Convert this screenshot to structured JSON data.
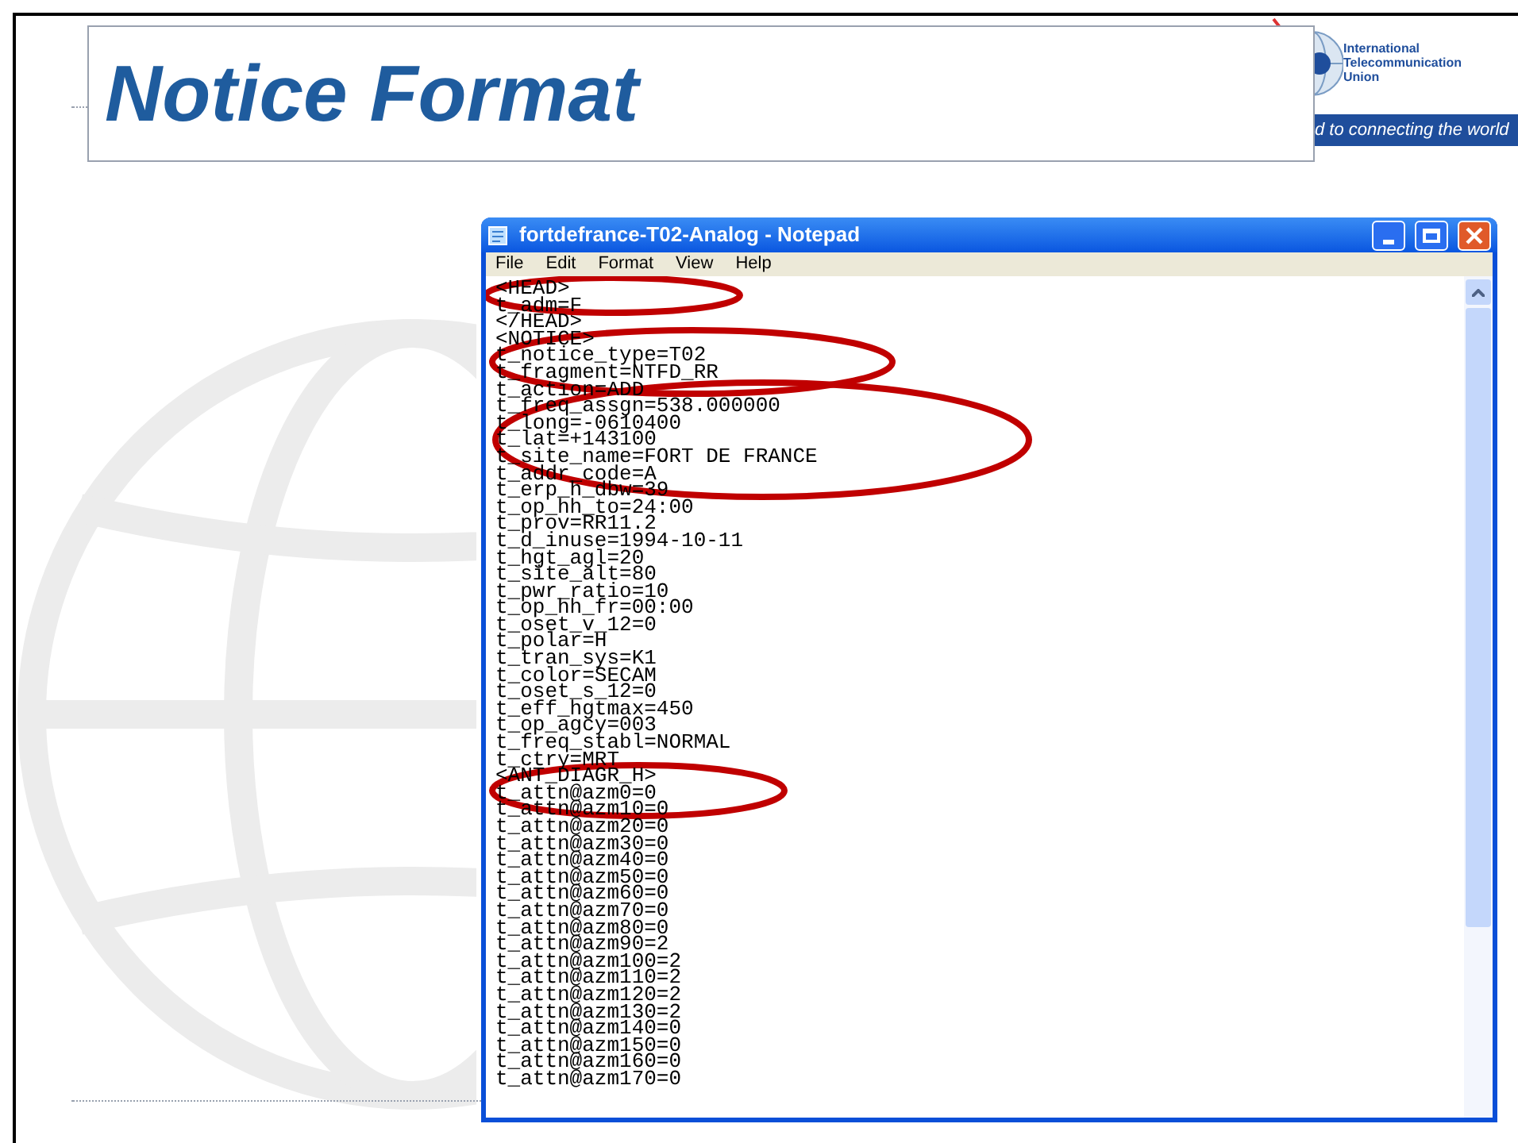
{
  "slide": {
    "title": "Notice Format"
  },
  "logo": {
    "name_lines": [
      "International",
      "Telecommunication",
      "Union"
    ],
    "tagline": "d to connecting the world"
  },
  "notepad": {
    "title": "fortdefrance-T02-Analog - Notepad",
    "menu": [
      "File",
      "Edit",
      "Format",
      "View",
      "Help"
    ],
    "lines": [
      "<HEAD>",
      "t_adm=F",
      "</HEAD>",
      "<NOTICE>",
      "t_notice_type=T02",
      "t_fragment=NTFD_RR",
      "t_action=ADD",
      "t_freq_assgn=538.000000",
      "t_long=-0610400",
      "t_lat=+143100",
      "t_site_name=FORT DE FRANCE",
      "t_addr_code=A",
      "t_erp_h_dbw=39",
      "t_op_hh_to=24:00",
      "t_prov=RR11.2",
      "t_d_inuse=1994-10-11",
      "t_hgt_agl=20",
      "t_site_alt=80",
      "t_pwr_ratio=10",
      "t_op_hh_fr=00:00",
      "t_oset_v_12=0",
      "t_polar=H",
      "t_tran_sys=K1",
      "t_color=SECAM",
      "t_oset_s_12=0",
      "t_eff_hgtmax=450",
      "t_op_agcy=003",
      "t_freq_stabl=NORMAL",
      "t_ctry=MRT",
      "<ANT_DIAGR_H>",
      "t_attn@azm0=0",
      "t_attn@azm10=0",
      "t_attn@azm20=0",
      "t_attn@azm30=0",
      "t_attn@azm40=0",
      "t_attn@azm50=0",
      "t_attn@azm60=0",
      "t_attn@azm70=0",
      "t_attn@azm80=0",
      "t_attn@azm90=2",
      "t_attn@azm100=2",
      "t_attn@azm110=2",
      "t_attn@azm120=2",
      "t_attn@azm130=2",
      "t_attn@azm140=0",
      "t_attn@azm150=0",
      "t_attn@azm160=0",
      "t_attn@azm170=0"
    ]
  }
}
